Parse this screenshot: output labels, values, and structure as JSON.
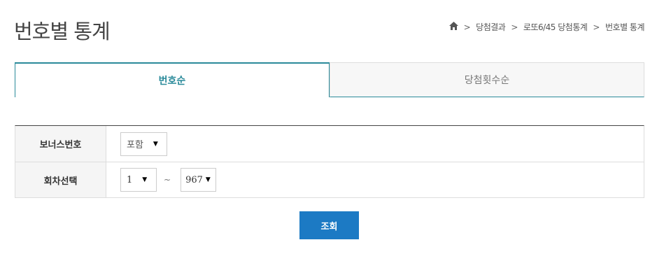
{
  "page": {
    "title": "번호별 통계"
  },
  "breadcrumb": {
    "items": [
      "당첨결과",
      "로또6/45 당첨통계",
      "번호별 통계"
    ],
    "separator": ">"
  },
  "tabs": [
    {
      "label": "번호순",
      "active": true
    },
    {
      "label": "당첨횟수순",
      "active": false
    }
  ],
  "form": {
    "bonus": {
      "label": "보너스번호",
      "selected": "포함"
    },
    "round": {
      "label": "회차선택",
      "from": "1",
      "tilde": "~",
      "to": "967"
    }
  },
  "actions": {
    "search_label": "조회"
  },
  "colors": {
    "accent": "#2a8a9a",
    "button": "#1c7ac4"
  }
}
